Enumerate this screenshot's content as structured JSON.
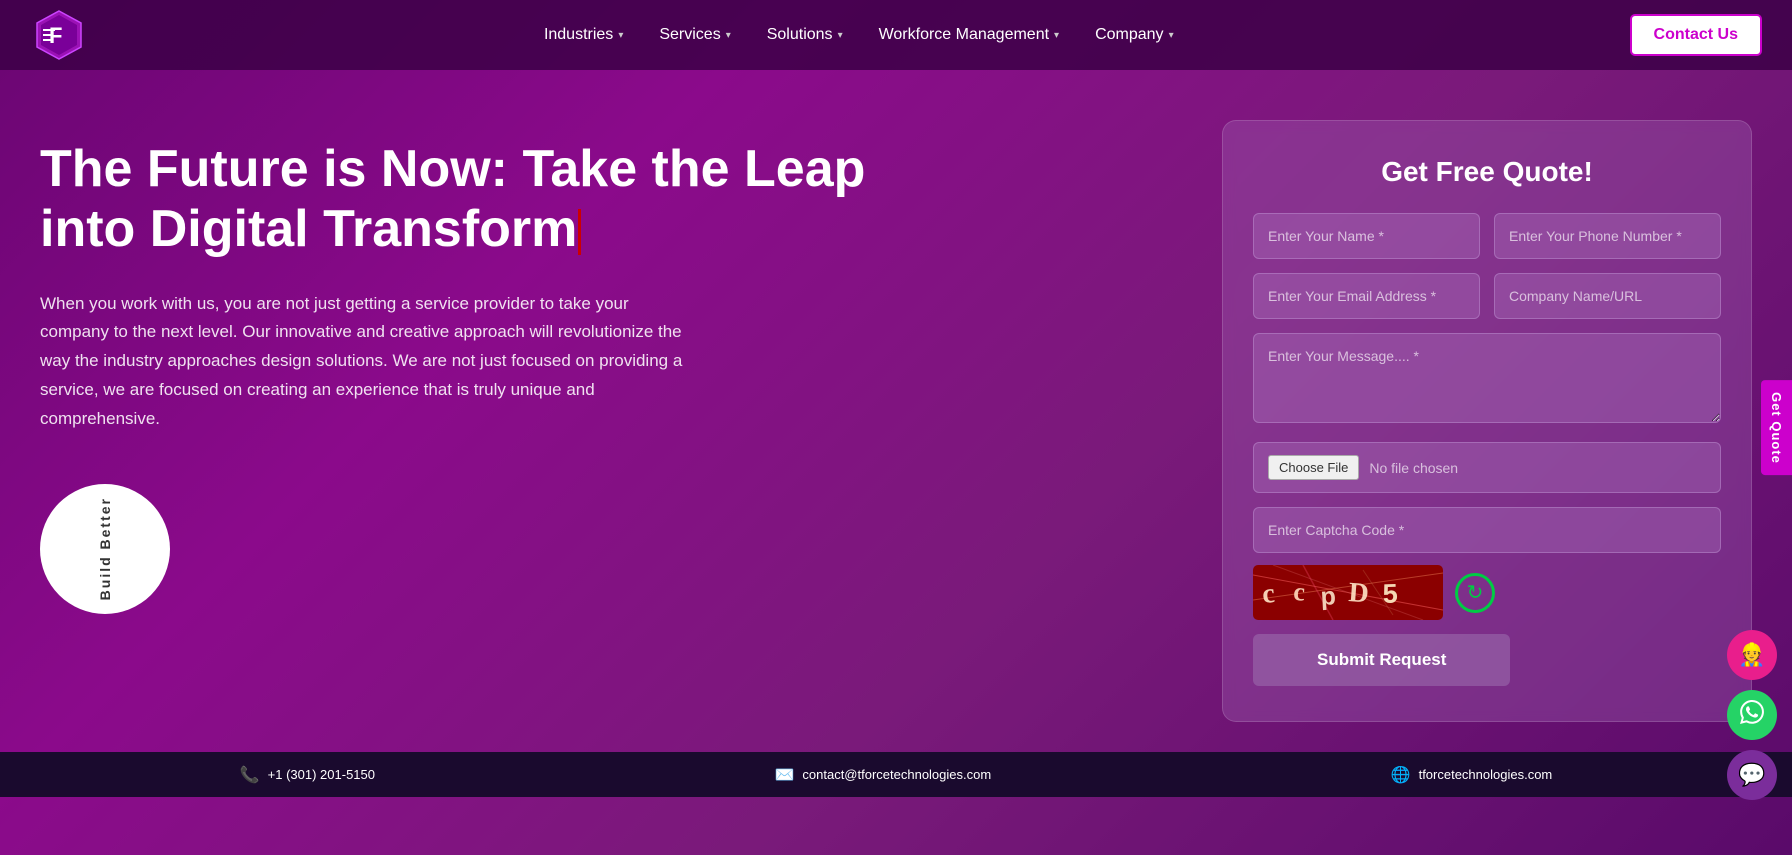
{
  "brand": {
    "logo_text": "F"
  },
  "navbar": {
    "items": [
      {
        "label": "Industries",
        "has_dropdown": true
      },
      {
        "label": "Services",
        "has_dropdown": true
      },
      {
        "label": "Solutions",
        "has_dropdown": true
      },
      {
        "label": "Workforce Management",
        "has_dropdown": true
      },
      {
        "label": "Company",
        "has_dropdown": true
      }
    ],
    "contact_label": "Contact Us"
  },
  "hero": {
    "title_line1": "The Future is Now: Take the Leap",
    "title_line2": "into Digital Transform",
    "description": "When you work with us, you are not just getting a service provider to take your company to the next level. Our innovative and creative approach will revolutionize the way the industry approaches design solutions. We are not just focused on providing a service, we are focused on creating an experience that is truly unique and comprehensive.",
    "circle_text": "Build Better"
  },
  "form": {
    "title": "Get Free Quote!",
    "name_placeholder": "Enter Your Name *",
    "phone_placeholder": "Enter Your Phone Number *",
    "email_placeholder": "Enter Your Email Address *",
    "company_placeholder": "Company Name/URL",
    "message_placeholder": "Enter Your Message.... *",
    "file_label": "No file chosen",
    "choose_file_label": "Choose File",
    "captcha_placeholder": "Enter Captcha Code *",
    "submit_label": "Submit Request",
    "refresh_icon": "↻"
  },
  "footer": {
    "items": [
      {
        "icon": "📞",
        "text": "+1 (301) 201-5150"
      },
      {
        "icon": "✉️",
        "text": "contact@tforcetechnologies.com"
      },
      {
        "icon": "🌐",
        "text": "tforcetechnologies.com"
      }
    ]
  },
  "floating": {
    "support_icon": "👷",
    "whatsapp_icon": "💬",
    "chat_icon": "💬"
  },
  "side_tab": {
    "label": "Get Quote"
  }
}
